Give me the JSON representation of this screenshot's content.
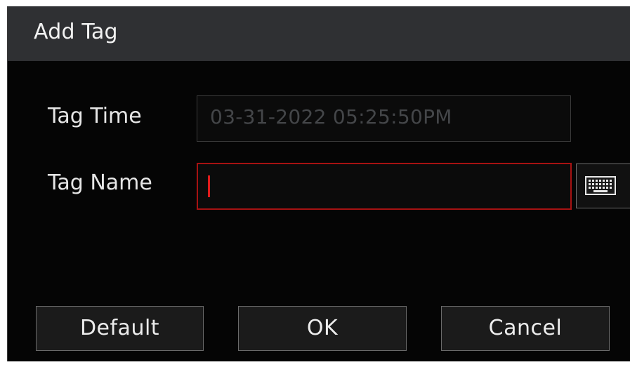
{
  "dialog": {
    "title": "Add Tag"
  },
  "form": {
    "tag_time_label": "Tag Time",
    "tag_time_value": "03-31-2022 05:25:50PM",
    "tag_name_label": "Tag Name",
    "tag_name_value": ""
  },
  "icons": {
    "keyboard": "keyboard-icon"
  },
  "buttons": {
    "default_label": "Default",
    "ok_label": "OK",
    "cancel_label": "Cancel"
  },
  "colors": {
    "active_border": "#a71212",
    "cursor": "#e01b1b",
    "titlebar_bg": "#2f3033",
    "dialog_bg": "#050505"
  }
}
